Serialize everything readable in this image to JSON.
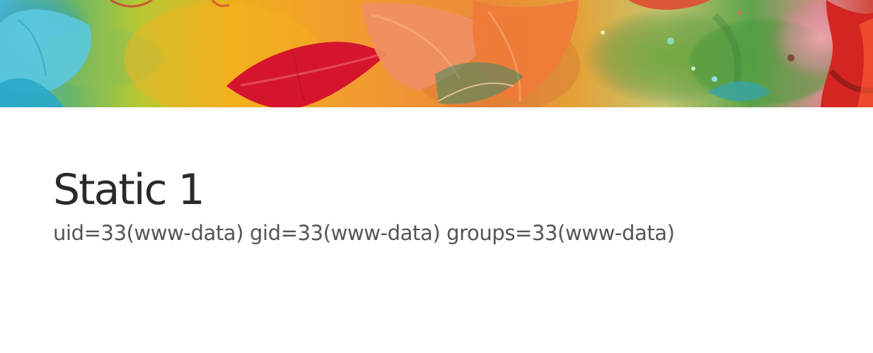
{
  "header": {
    "image_description": "watercolor leaves"
  },
  "main": {
    "title": "Static 1",
    "user_info": "uid=33(www-data) gid=33(www-data) groups=33(www-data)"
  },
  "colors": {
    "title": "#2a2a2a",
    "body_text": "#555555",
    "background": "#ffffff"
  }
}
